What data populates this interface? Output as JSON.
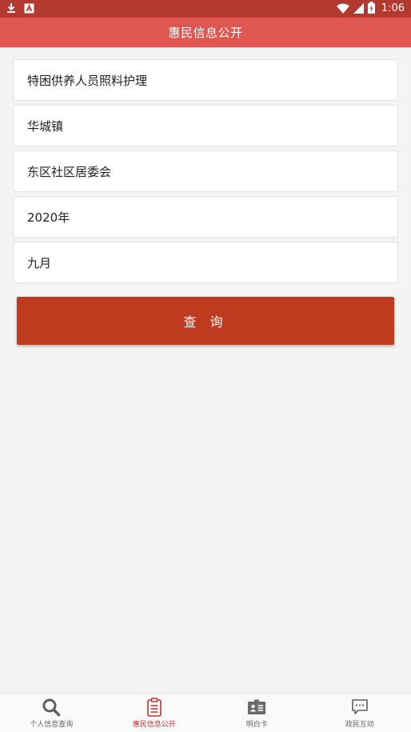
{
  "status_bar": {
    "time": "1:06",
    "icons": [
      "download-icon",
      "a-badge-icon",
      "wifi-icon",
      "signal-icon",
      "battery-icon"
    ]
  },
  "header": {
    "title": "惠民信息公开"
  },
  "form": {
    "fields": [
      {
        "value": "特困供养人员照料护理"
      },
      {
        "value": "华城镇"
      },
      {
        "value": "东区社区居委会"
      },
      {
        "value": "2020年"
      },
      {
        "value": "九月"
      }
    ],
    "query_label": "查 询"
  },
  "bottom_nav": {
    "items": [
      {
        "label": "个人信息查询",
        "icon": "search-icon",
        "active": false
      },
      {
        "label": "惠民信息公开",
        "icon": "clipboard-icon",
        "active": true
      },
      {
        "label": "明白卡",
        "icon": "id-card-icon",
        "active": false
      },
      {
        "label": "政民互动",
        "icon": "chat-icon",
        "active": false
      }
    ]
  },
  "colors": {
    "status_bar": "#b3382f",
    "header": "#e05651",
    "button": "#bf3b1f",
    "active_nav": "#c9302c",
    "background": "#f4f4f4"
  }
}
